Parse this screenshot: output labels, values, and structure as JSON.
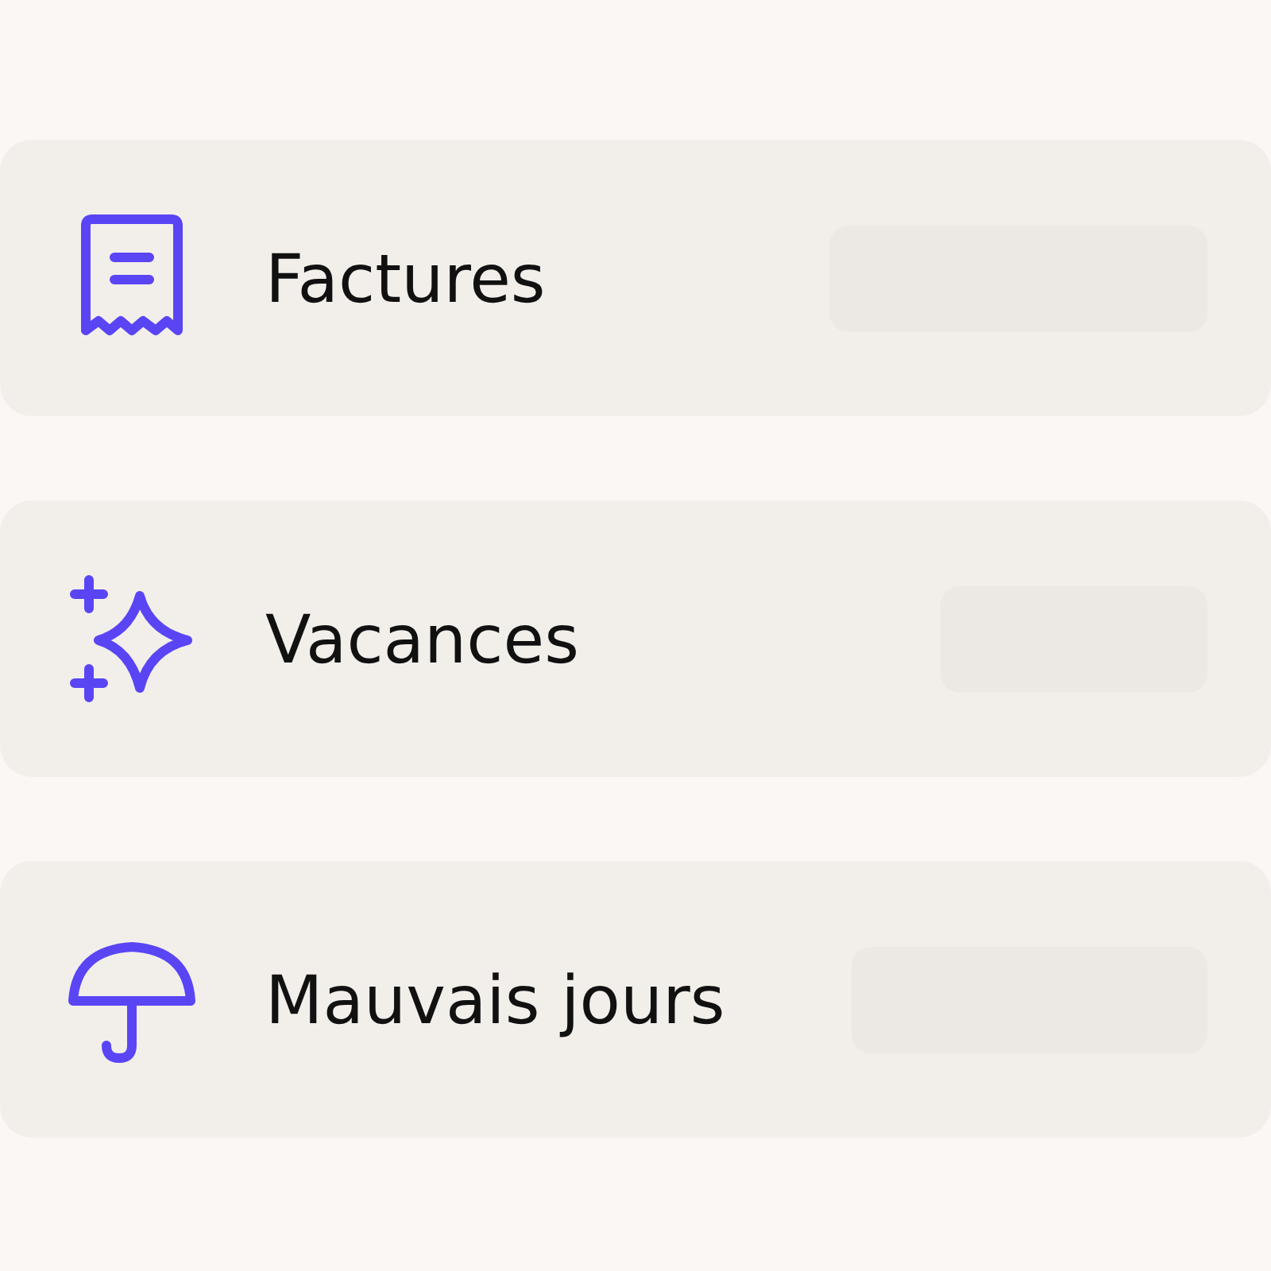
{
  "categories": [
    {
      "label": "Factures"
    },
    {
      "label": "Vacances"
    },
    {
      "label": "Mauvais jours"
    }
  ]
}
